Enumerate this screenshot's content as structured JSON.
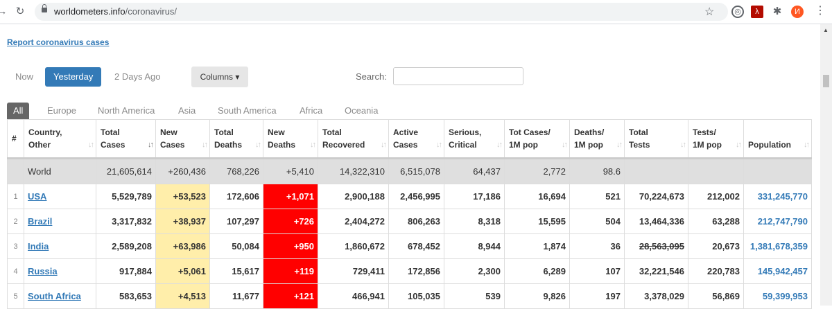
{
  "browser": {
    "url_host": "worldometers.info",
    "url_path": "/coronavirus/",
    "avatar_letter": "И"
  },
  "report_link": "Report coronavirus cases",
  "day_tabs": [
    "Now",
    "Yesterday",
    "2 Days Ago"
  ],
  "day_tab_selected": "Yesterday",
  "columns_button": "Columns ▾",
  "search": {
    "label": "Search:",
    "value": ""
  },
  "region_tabs": [
    "All",
    "Europe",
    "North America",
    "Asia",
    "South America",
    "Africa",
    "Oceania"
  ],
  "region_tab_selected": "All",
  "table": {
    "headers": [
      [
        "#",
        ""
      ],
      [
        "Country,",
        "Other"
      ],
      [
        "Total",
        "Cases"
      ],
      [
        "New",
        "Cases"
      ],
      [
        "Total",
        "Deaths"
      ],
      [
        "New",
        "Deaths"
      ],
      [
        "Total",
        "Recovered"
      ],
      [
        "Active",
        "Cases"
      ],
      [
        "Serious,",
        "Critical"
      ],
      [
        "Tot Cases/",
        "1M pop"
      ],
      [
        "Deaths/",
        "1M pop"
      ],
      [
        "Total",
        "Tests"
      ],
      [
        "Tests/",
        "1M pop"
      ],
      [
        "",
        "Population"
      ]
    ],
    "world": [
      "",
      "World",
      "21,605,614",
      "+260,436",
      "768,226",
      "+5,410",
      "14,322,310",
      "6,515,078",
      "64,437",
      "2,772",
      "98.6",
      "",
      "",
      ""
    ],
    "rows": [
      [
        "1",
        "USA",
        "5,529,789",
        "+53,523",
        "172,606",
        "+1,071",
        "2,900,188",
        "2,456,995",
        "17,186",
        "16,694",
        "521",
        "70,224,673",
        "212,002",
        "331,245,770"
      ],
      [
        "2",
        "Brazil",
        "3,317,832",
        "+38,937",
        "107,297",
        "+726",
        "2,404,272",
        "806,263",
        "8,318",
        "15,595",
        "504",
        "13,464,336",
        "63,288",
        "212,747,790"
      ],
      [
        "3",
        "India",
        "2,589,208",
        "+63,986",
        "50,084",
        "+950",
        "1,860,672",
        "678,452",
        "8,944",
        "1,874",
        "36",
        "28,563,095",
        "20,673",
        "1,381,678,359"
      ],
      [
        "4",
        "Russia",
        "917,884",
        "+5,061",
        "15,617",
        "+119",
        "729,411",
        "172,856",
        "2,300",
        "6,289",
        "107",
        "32,221,546",
        "220,783",
        "145,942,457"
      ],
      [
        "5",
        "South Africa",
        "583,653",
        "+4,513",
        "11,677",
        "+121",
        "466,941",
        "105,035",
        "539",
        "9,826",
        "197",
        "3,378,029",
        "56,869",
        "59,399,953"
      ]
    ]
  },
  "colors": {
    "link": "#337ab7",
    "new_cases_bg": "#ffeeaa",
    "new_deaths_bg": "#ff0000",
    "world_row_bg": "#dfdfdf"
  }
}
